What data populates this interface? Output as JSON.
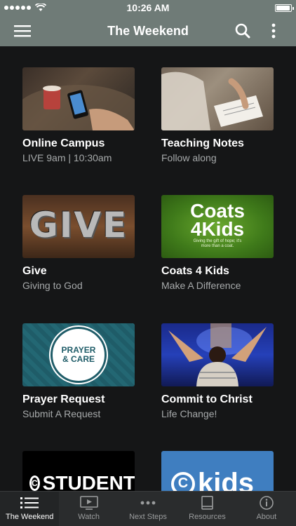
{
  "status_bar": {
    "time": "10:26 AM"
  },
  "nav": {
    "title": "The Weekend"
  },
  "cards": [
    {
      "title": "Online Campus",
      "subtitle": "LIVE 9am | 10:30am"
    },
    {
      "title": "Teaching Notes",
      "subtitle": "Follow along"
    },
    {
      "title": "Give",
      "subtitle": "Giving to God",
      "thumb_text": "GIVE"
    },
    {
      "title": "Coats 4 Kids",
      "subtitle": "Make A Difference",
      "thumb_title": "Coats 4Kids",
      "thumb_tagline": "Giving the gift of hope; it's more than a coat."
    },
    {
      "title": "Prayer Request",
      "subtitle": "Submit A Request",
      "thumb_line1": "PRAYER",
      "thumb_line2": "& CARE"
    },
    {
      "title": "Commit to Christ",
      "subtitle": "Life Change!"
    },
    {
      "thumb_text": "STUDENTS"
    },
    {
      "thumb_text": "kids"
    }
  ],
  "tabs": [
    {
      "label": "The Weekend",
      "icon": "list-icon",
      "active": true
    },
    {
      "label": "Watch",
      "icon": "play-screen-icon",
      "active": false
    },
    {
      "label": "Next Steps",
      "icon": "ellipsis-icon",
      "active": false
    },
    {
      "label": "Resources",
      "icon": "book-icon",
      "active": false
    },
    {
      "label": "About",
      "icon": "info-icon",
      "active": false
    }
  ],
  "colors": {
    "nav_bg": "#6f7b77",
    "page_bg": "#151617",
    "tab_bg": "#2a2c2d",
    "subtitle": "#a7aaab"
  }
}
